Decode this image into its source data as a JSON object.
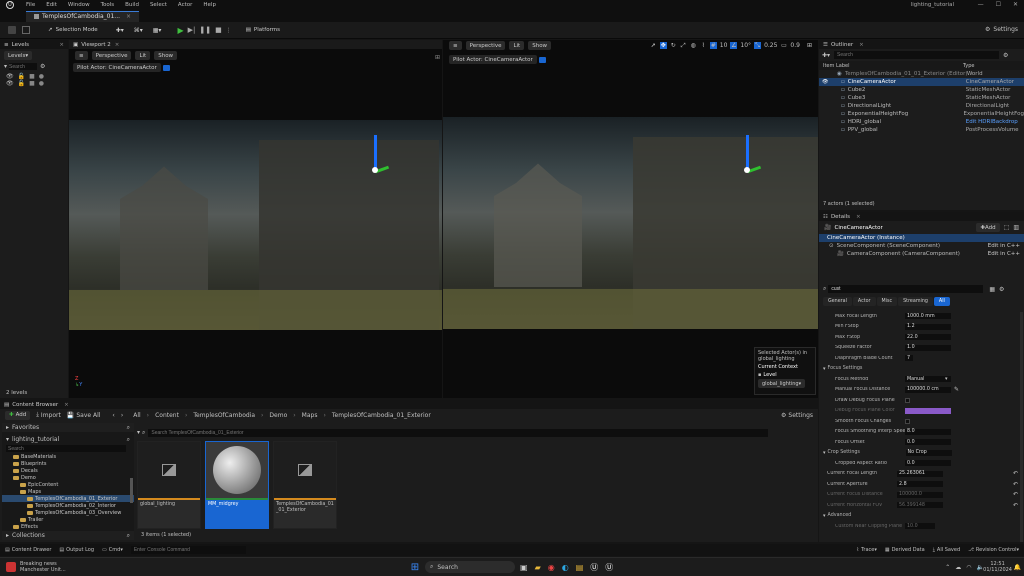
{
  "app": {
    "logo": "unreal-logo",
    "title": "lighting_tutorial"
  },
  "menu": [
    "File",
    "Edit",
    "Window",
    "Tools",
    "Build",
    "Select",
    "Actor",
    "Help"
  ],
  "tab": {
    "label": "TemplesOfCambodia_01..."
  },
  "toolbar": {
    "mode": "Selection Mode",
    "platforms": "Platforms",
    "settings": "Settings"
  },
  "levels": {
    "title": "Levels",
    "levels_btn": "Levels",
    "search_placeholder": "Search",
    "count": "2 levels"
  },
  "viewport2": {
    "title": "Viewport 2",
    "perspective": "Perspective",
    "lit": "Lit",
    "show": "Show",
    "pilot": "Pilot Actor: CineCameraActor"
  },
  "viewport1": {
    "perspective": "Perspective",
    "lit": "Lit",
    "show": "Show",
    "pilot": "Pilot Actor: CineCameraActor",
    "grid": "10",
    "angle": "10°",
    "scale": "0.25",
    "speed": "0.9"
  },
  "context": {
    "selected": "Selected Actor(s) in",
    "level_name": "global_lighting",
    "current_context": "Current Context",
    "level_label": "Level",
    "level_value": "global_lighting"
  },
  "outliner": {
    "title": "Outliner",
    "search_placeholder": "Search",
    "col_label": "Item Label",
    "col_type": "Type",
    "rows": [
      {
        "label": "TemplesOfCambodia_01_01_Exterior (Editor)",
        "type": "World"
      },
      {
        "label": "CineCameraActor",
        "type": "CineCameraActor"
      },
      {
        "label": "Cube2",
        "type": "StaticMeshActor"
      },
      {
        "label": "Cube3",
        "type": "StaticMeshActor"
      },
      {
        "label": "DirectionalLight",
        "type": "DirectionalLight"
      },
      {
        "label": "ExponentialHeightFog",
        "type": "ExponentialHeightFog"
      },
      {
        "label": "HDRI_global",
        "type": "Edit HDRIBackdrop"
      },
      {
        "label": "PPV_global",
        "type": "PostProcessVolume"
      }
    ],
    "status": "7 actors (1 selected)"
  },
  "details": {
    "title": "Details",
    "actor": "CineCameraActor",
    "add": "Add",
    "instance": "CineCameraActor (Instance)",
    "components": [
      {
        "label": "SceneComponent (SceneComponent)",
        "link": "Edit in C++"
      },
      {
        "label": "CameraComponent (CameraComponent)",
        "link": "Edit in C++"
      }
    ],
    "search_value": "cust",
    "filters": [
      "General",
      "Actor",
      "Misc",
      "Streaming",
      "All"
    ],
    "props": [
      {
        "label": "Max Focal Length",
        "value": "1000.0 mm"
      },
      {
        "label": "Min FStop",
        "value": "1.2"
      },
      {
        "label": "Max FStop",
        "value": "22.0"
      },
      {
        "label": "Squeeze Factor",
        "value": "1.0"
      },
      {
        "label": "Diaphragm Blade Count",
        "value": "7"
      }
    ],
    "focus_section": "Focus Settings",
    "focus": [
      {
        "label": "Focus Method",
        "value": "Manual"
      },
      {
        "label": "Manual Focus Distance",
        "value": "100000.0 cm"
      },
      {
        "label": "Draw Debug Focus Plane",
        "value": ""
      },
      {
        "label": "Debug Focus Plane Color",
        "value": ""
      },
      {
        "label": "Smooth Focus Changes",
        "value": ""
      },
      {
        "label": "Focus Smoothing Interp Speed",
        "value": "8.0"
      },
      {
        "label": "Focus Offset",
        "value": "0.0"
      }
    ],
    "crop_section": "Crop Settings",
    "crop_value": "No Crop",
    "crop": [
      {
        "label": "Cropped Aspect Ratio",
        "value": "0.0"
      }
    ],
    "current": [
      {
        "label": "Current Focal Length",
        "value": "25.263061"
      },
      {
        "label": "Current Aperture",
        "value": "2.8"
      },
      {
        "label": "Current Focus Distance",
        "value": "100000.0"
      },
      {
        "label": "Current Horizontal FOV",
        "value": "56.399148"
      }
    ],
    "advanced": "Advanced",
    "near_clip": "Custom Near Clipping Plane",
    "near_val": "10.0"
  },
  "content_browser": {
    "title": "Content Browser",
    "add": "Add",
    "import": "Import",
    "save_all": "Save All",
    "settings": "Settings",
    "breadcrumb": [
      "All",
      "Content",
      "TemplesOfCambodia",
      "Demo",
      "Maps",
      "TemplesOfCambodia_01_Exterior"
    ],
    "favorites": "Favorites",
    "project": "lighting_tutorial",
    "search_placeholder": "Search TemplesOfCambodia_01_Exterior",
    "folder_search": "Search",
    "folders": [
      {
        "label": "BaseMaterials",
        "indent": 1
      },
      {
        "label": "Blueprints",
        "indent": 1
      },
      {
        "label": "Decals",
        "indent": 1
      },
      {
        "label": "Demo",
        "indent": 1
      },
      {
        "label": "EpicContent",
        "indent": 2
      },
      {
        "label": "Maps",
        "indent": 2
      },
      {
        "label": "TemplesOfCambodia_01_Exterior",
        "indent": 3,
        "selected": true
      },
      {
        "label": "TemplesOfCambodia_02_Interior",
        "indent": 3
      },
      {
        "label": "TemplesOfCambodia_03_Overview",
        "indent": 3
      },
      {
        "label": "Trailer",
        "indent": 2
      },
      {
        "label": "Effects",
        "indent": 1
      },
      {
        "label": "Environment",
        "indent": 1
      }
    ],
    "collections": "Collections",
    "assets": [
      {
        "label": "global_lighting",
        "type": "level"
      },
      {
        "label": "MM_midgrey",
        "type": "material",
        "selected": true
      },
      {
        "label": "TemplesOfCambodia_01_01_Exterior",
        "type": "level"
      }
    ],
    "status": "3 items (1 selected)"
  },
  "bottombar": {
    "drawer": "Content Drawer",
    "output": "Output Log",
    "cmd": "Cmd",
    "console_placeholder": "Enter Console Command",
    "trace": "Trace",
    "derived": "Derived Data",
    "saved": "All Saved",
    "revision": "Revision Control"
  },
  "taskbar": {
    "news_title": "Breaking news",
    "news_sub": "Manchester Unit...",
    "search": "Search",
    "time": "12:51",
    "date": "01/11/2024"
  },
  "colors": {
    "accent": "#1966d2",
    "selection": "#1d3f6b",
    "folder": "#c9a24a"
  }
}
